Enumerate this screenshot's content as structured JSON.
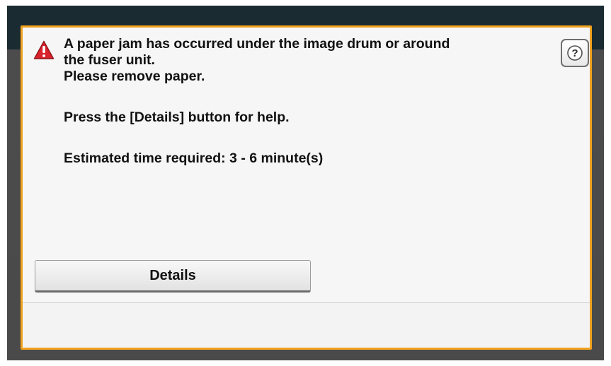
{
  "dialog": {
    "message_lines": [
      "A paper jam has occurred under the image drum or around",
      "the fuser unit.",
      "Please remove paper.",
      "Press the [Details] button for help.",
      "Estimated time required: 3 - 6 minute(s)"
    ],
    "help_label": "?",
    "details_label": "Details",
    "warning_icon": "warning-triangle-icon",
    "help_icon": "help-question-icon"
  },
  "colors": {
    "dialog_border": "#f0a21f",
    "warning_red": "#d9232c",
    "screen_bezel": "#4c4c4c"
  }
}
